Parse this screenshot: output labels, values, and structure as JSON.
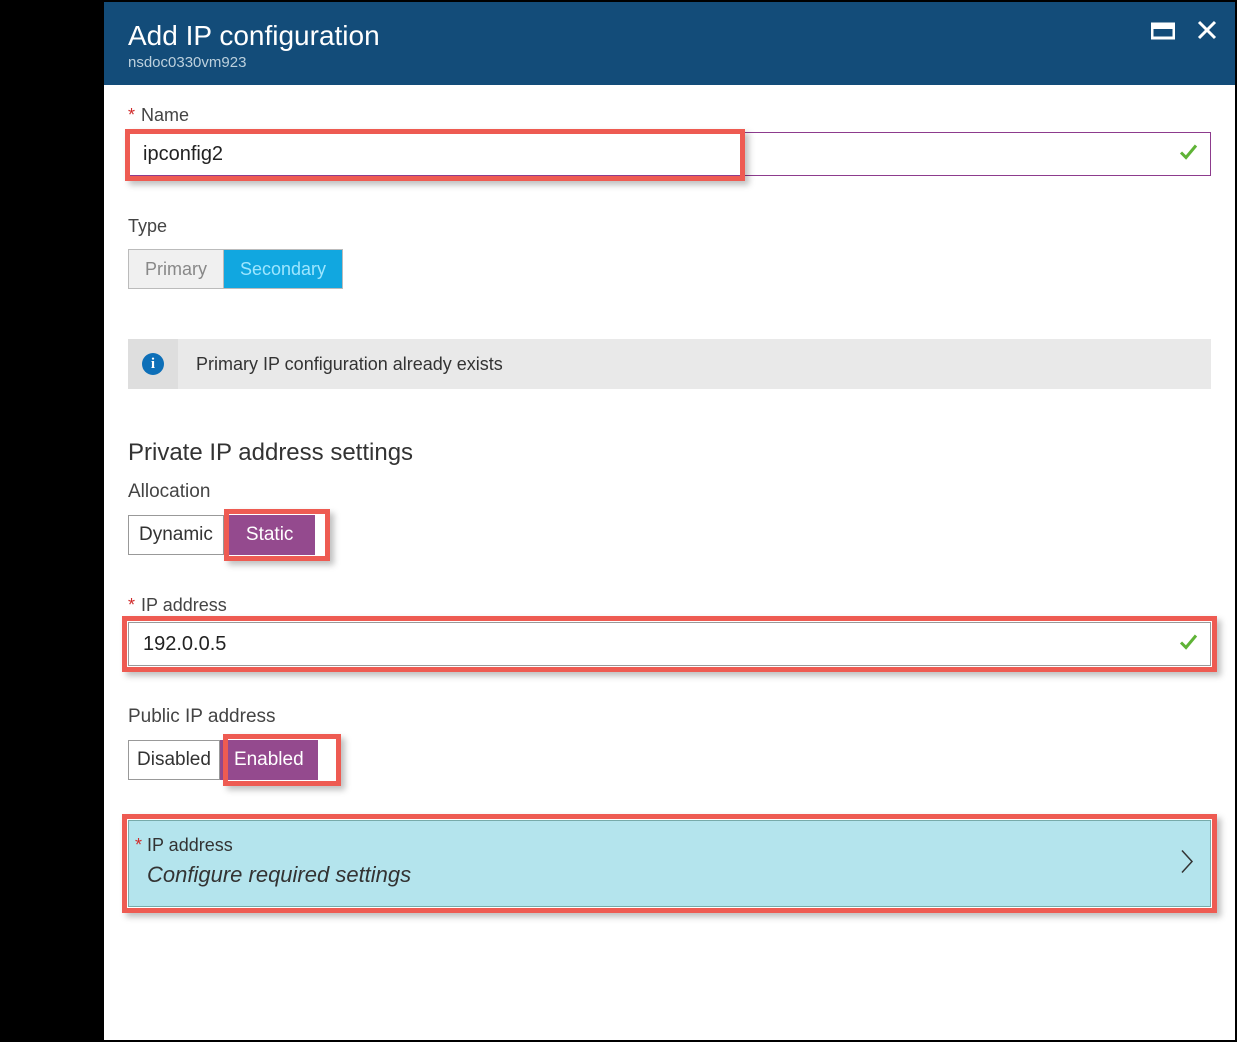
{
  "header": {
    "title": "Add IP configuration",
    "subtitle": "nsdoc0330vm923"
  },
  "name": {
    "label": "Name",
    "value": "ipconfig2"
  },
  "type": {
    "label": "Type",
    "primary": "Primary",
    "secondary": "Secondary"
  },
  "info": {
    "text": "Primary IP configuration already exists"
  },
  "private": {
    "heading": "Private IP address settings",
    "allocation_label": "Allocation",
    "dynamic": "Dynamic",
    "static": "Static",
    "ip_label": "IP address",
    "ip_value": "192.0.0.5"
  },
  "public": {
    "label": "Public IP address",
    "disabled": "Disabled",
    "enabled": "Enabled"
  },
  "picker": {
    "label": "IP address",
    "sub": "Configure required settings"
  }
}
